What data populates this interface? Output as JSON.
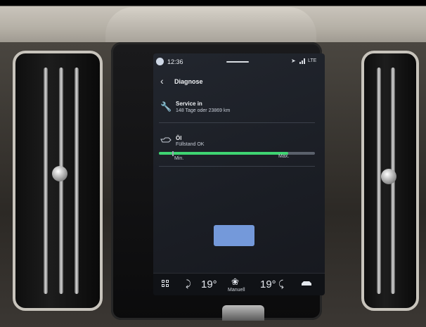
{
  "status_bar": {
    "time": "12:36",
    "network": "LTE",
    "icons": [
      "profile-icon",
      "navigation-arrow-icon",
      "signal-icon"
    ]
  },
  "header": {
    "title": "Diagnose",
    "back_icon": "chevron-left-icon"
  },
  "service": {
    "icon": "wrench-icon",
    "title": "Service in",
    "subtitle": "148 Tage oder 23869 km"
  },
  "oil": {
    "icon": "oil-can-icon",
    "title": "Öl",
    "subtitle": "Füllstand OK",
    "level_fraction": 0.83,
    "min_label": "Min.",
    "max_label": "Max.",
    "fill_color": "#3fd472"
  },
  "climate": {
    "temp_left": "19°",
    "temp_right": "19°",
    "fan_label": "Manuell",
    "icons": [
      "apps-grid-icon",
      "seat-heat-left-icon",
      "fan-icon",
      "seat-heat-right-icon",
      "car-icon"
    ]
  }
}
